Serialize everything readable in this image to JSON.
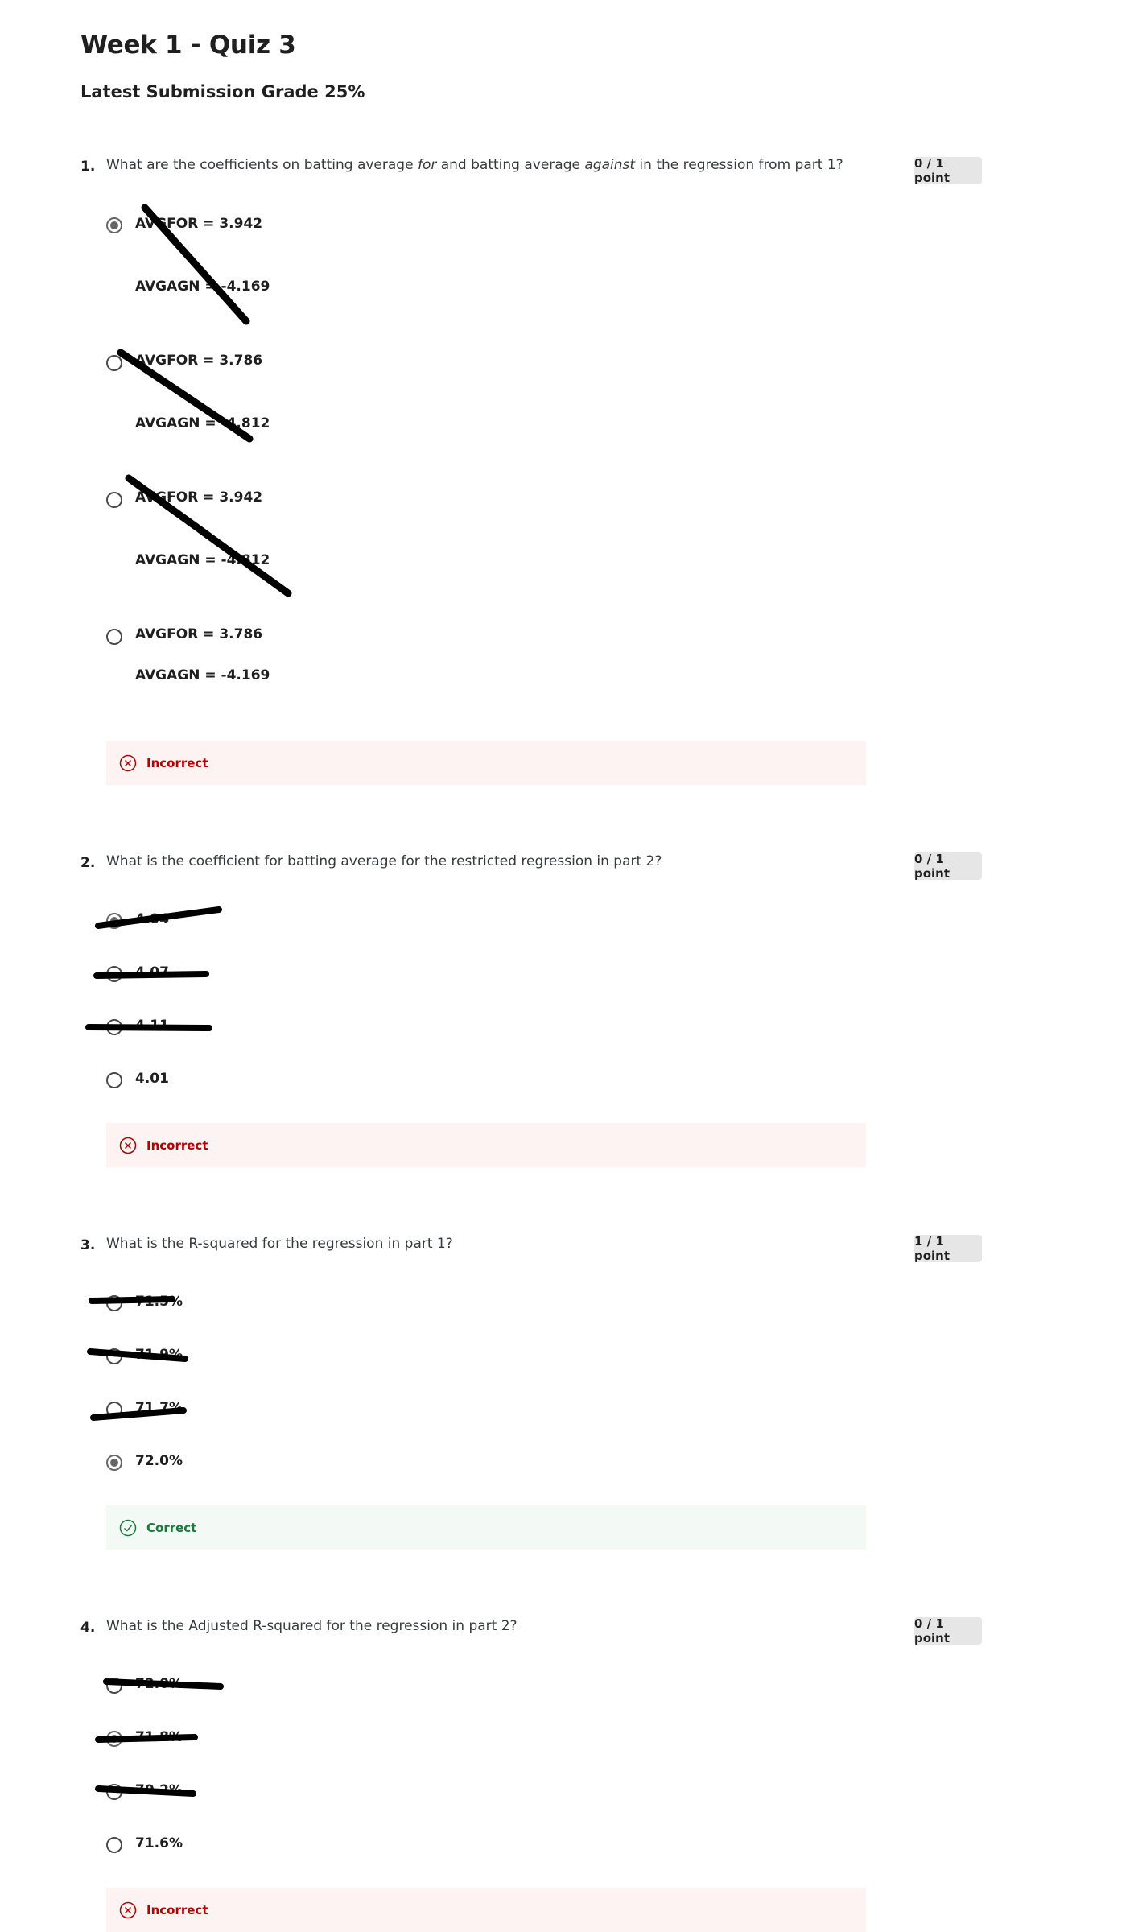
{
  "header": {
    "title": "Week 1 - Quiz 3",
    "grade_label": "Latest Submission Grade",
    "grade_value": "25%"
  },
  "questions": [
    {
      "number": "1.",
      "text_part1": "What are the coefficients on batting average ",
      "text_em1": "for",
      "text_part2": " and batting average ",
      "text_em2": "against",
      "text_part3": " in the regression from part 1?",
      "points": "0 / 1 point",
      "options": [
        {
          "line1": "AVGFOR = 3.942",
          "line2": "AVGAGN = -4.169",
          "selected": true
        },
        {
          "line1": "AVGFOR = 3.786",
          "line2": "AVGAGN = -4.812",
          "selected": false
        },
        {
          "line1": "AVGFOR = 3.942",
          "line2": "AVGAGN = -4.812",
          "selected": false
        },
        {
          "line1": "AVGFOR = 3.786",
          "line2": "AVGAGN = -4.169",
          "selected": false
        }
      ],
      "feedback": "Incorrect"
    },
    {
      "number": "2.",
      "text": "What is the coefficient for batting average for the restricted regression in part 2?",
      "points": "0 / 1 point",
      "options": [
        {
          "label": "4.04",
          "selected": true
        },
        {
          "label": "4.07",
          "selected": false
        },
        {
          "label": "4.11",
          "selected": false
        },
        {
          "label": "4.01",
          "selected": false
        }
      ],
      "feedback": "Incorrect"
    },
    {
      "number": "3.",
      "text": "What is the R-squared for the regression in part 1?",
      "points": "1 / 1 point",
      "options": [
        {
          "label": "71.5%",
          "selected": false
        },
        {
          "label": "71.9%",
          "selected": false
        },
        {
          "label": "71.7%",
          "selected": false
        },
        {
          "label": "72.0%",
          "selected": true
        }
      ],
      "feedback": "Correct"
    },
    {
      "number": "4.",
      "text": "What is the Adjusted R-squared for the regression in part 2?",
      "points": "0 / 1 point",
      "options": [
        {
          "label": "72.0%",
          "selected": false
        },
        {
          "label": "71.8%",
          "selected": true
        },
        {
          "label": "70.2%",
          "selected": false
        },
        {
          "label": "71.6%",
          "selected": false
        }
      ],
      "feedback": "Incorrect"
    }
  ],
  "colors": {
    "incorrect": "#b30000",
    "correct": "#1b7a3c",
    "points_badge_bg": "#e6e6e6"
  },
  "icons": {
    "incorrect": "x-circle-icon",
    "correct": "check-circle-icon"
  }
}
